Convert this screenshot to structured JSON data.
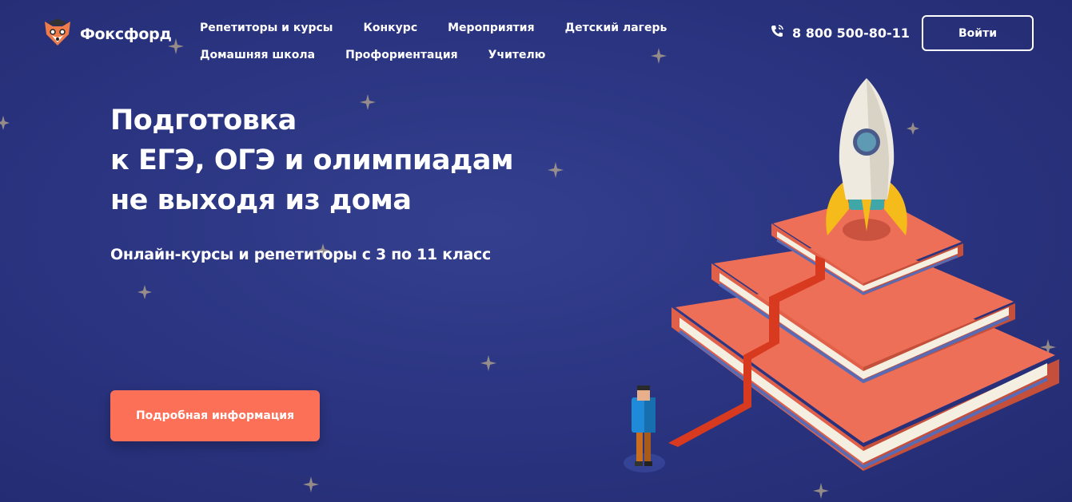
{
  "header": {
    "logo_text": "Фоксфорд",
    "nav_row1": [
      "Репетиторы и курсы",
      "Конкурс",
      "Мероприятия",
      "Детский лагерь"
    ],
    "nav_row2": [
      "Домашняя школа",
      "Профориентация",
      "Учителю"
    ],
    "phone": "8 800 500-80-11",
    "login_label": "Войти"
  },
  "hero": {
    "title_lines": [
      "Подготовка",
      "к ЕГЭ, ОГЭ и олимпиадам",
      "не выходя из дома"
    ],
    "subtitle": "Онлайн-курсы и репетиторы с 3 по 11 класс",
    "cta_label": "Подробная информация"
  },
  "icons": {
    "logo": "fox-logo-icon",
    "phone": "phone-icon"
  },
  "colors": {
    "background": "#2b3582",
    "cta": "#fd7058",
    "book": "#ee6f58",
    "bookmark": "#d83a1f"
  }
}
